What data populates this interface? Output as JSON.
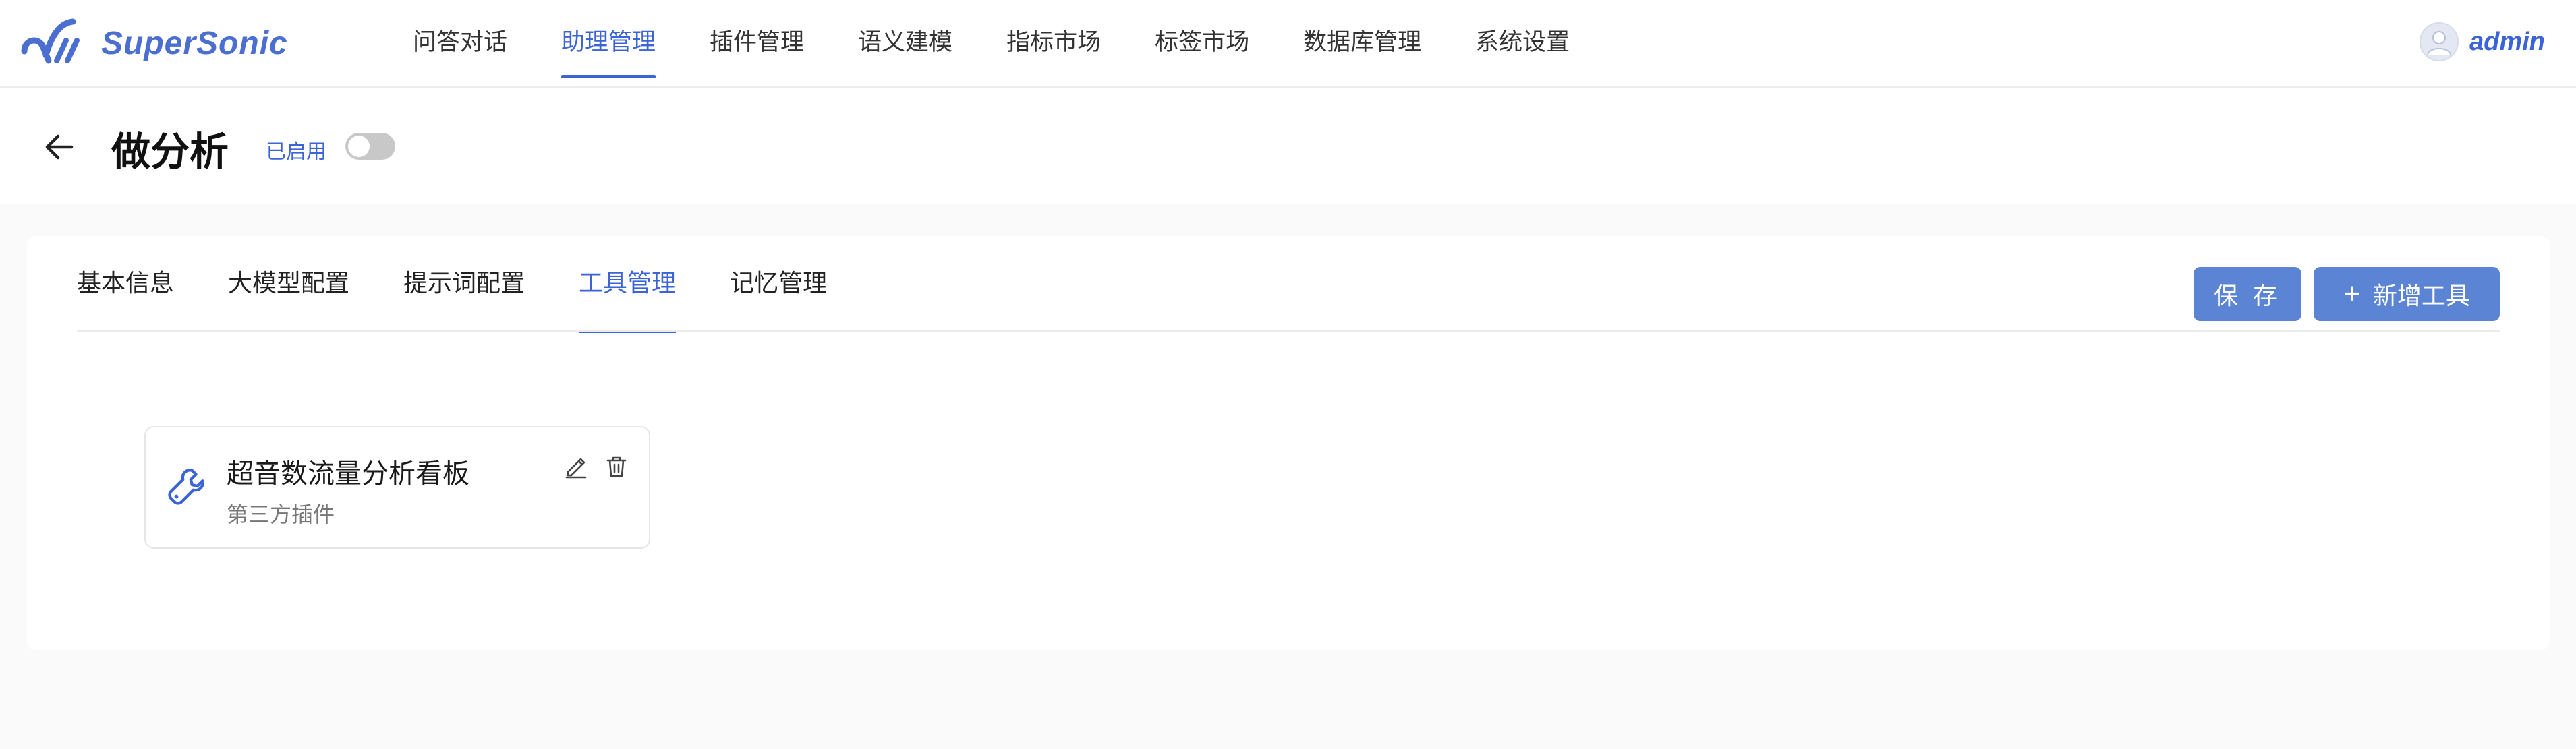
{
  "app": {
    "name": "SuperSonic"
  },
  "nav": {
    "items": [
      {
        "label": "问答对话"
      },
      {
        "label": "助理管理"
      },
      {
        "label": "插件管理"
      },
      {
        "label": "语义建模"
      },
      {
        "label": "指标市场"
      },
      {
        "label": "标签市场"
      },
      {
        "label": "数据库管理"
      },
      {
        "label": "系统设置"
      }
    ],
    "active_index": 1
  },
  "user": {
    "name": "admin"
  },
  "page": {
    "title": "做分析",
    "status_label": "已启用",
    "toggle_on": false
  },
  "tabs": {
    "items": [
      {
        "label": "基本信息"
      },
      {
        "label": "大模型配置"
      },
      {
        "label": "提示词配置"
      },
      {
        "label": "工具管理"
      },
      {
        "label": "记忆管理"
      }
    ],
    "active_index": 3
  },
  "actions": {
    "save_label": "保 存",
    "add_tool_label": "新增工具"
  },
  "tools": [
    {
      "name": "超音数流量分析看板",
      "type": "第三方插件",
      "icon": "wrench-icon"
    }
  ],
  "colors": {
    "primary": "#3b64d6",
    "button": "#5b85d4",
    "page_bg": "#fafafa"
  }
}
